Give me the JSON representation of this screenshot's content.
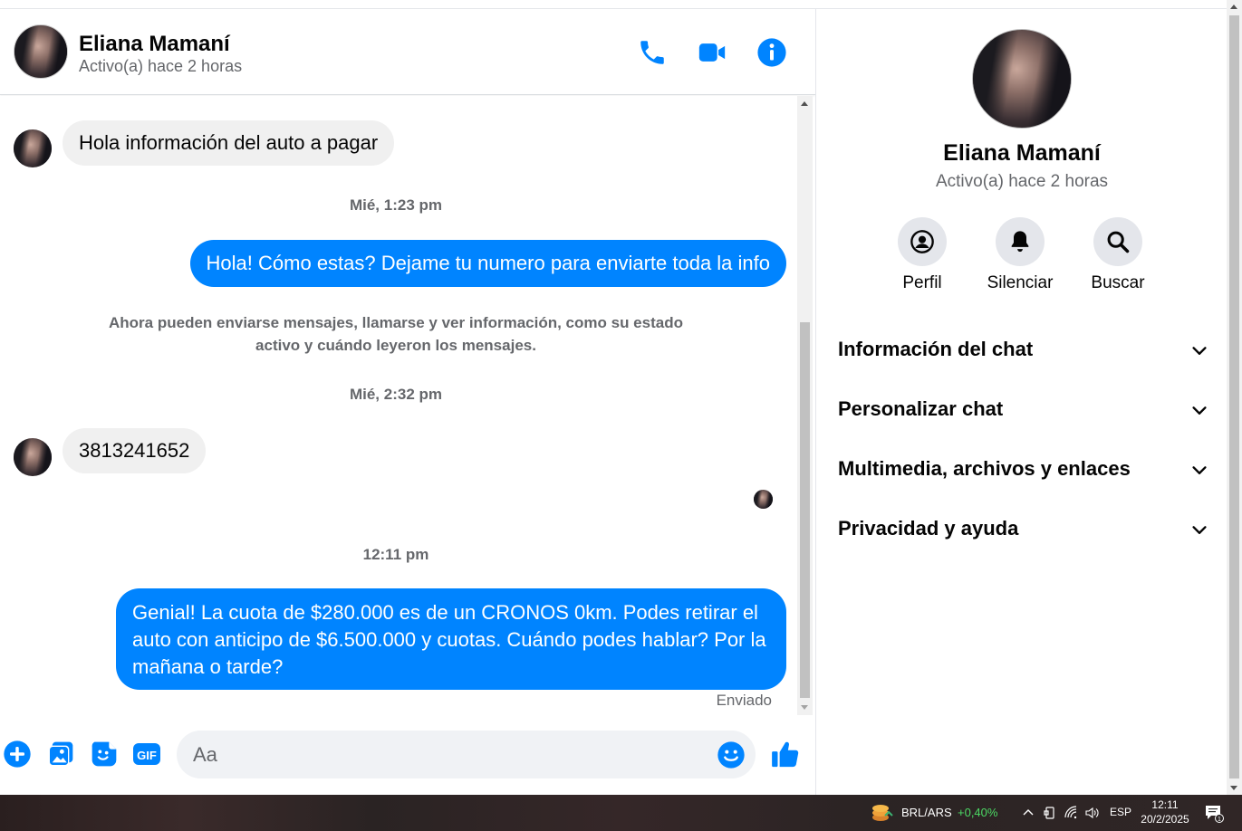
{
  "header": {
    "name": "Eliana Mamaní",
    "status": "Activo(a) hace 2 horas",
    "icons": [
      "phone-icon",
      "video-icon",
      "info-icon"
    ]
  },
  "messages": {
    "m1": "Hola información del auto a pagar",
    "ts1": "Mié, 1:23 pm",
    "m2": "Hola! Cómo estas? Dejame tu numero para enviarte toda la info",
    "sysnote": "Ahora pueden enviarse mensajes, llamarse y ver información, como su estado activo y cuándo leyeron los mensajes.",
    "ts2": "Mié, 2:32 pm",
    "m3": "3813241652",
    "ts3": "12:11 pm",
    "m4": "Genial! La cuota de $280.000 es de un CRONOS 0km. Podes retirar el auto con anticipo de $6.500.000 y cuotas. Cuándo podes hablar? Por la mañana o tarde?",
    "sent_label": "Enviado"
  },
  "composer": {
    "placeholder": "Aa",
    "icons": [
      "plus-icon",
      "image-icon",
      "sticker-icon",
      "gif-icon",
      "emoji-icon",
      "like-icon"
    ],
    "gif_label": "GIF"
  },
  "right_panel": {
    "name": "Eliana Mamaní",
    "status": "Activo(a) hace 2 horas",
    "actions": [
      "Perfil",
      "Silenciar",
      "Buscar"
    ],
    "sections": [
      "Información del chat",
      "Personalizar chat",
      "Multimedia, archivos y enlaces",
      "Privacidad y ayuda"
    ]
  },
  "taskbar": {
    "ticker": "BRL/ARS",
    "change": "+0,40%",
    "lang": "ESP",
    "time": "12:11",
    "date": "20/2/2025",
    "notif_count": "1"
  },
  "colors": {
    "accent": "#0084ff",
    "incoming_bubble": "#f0f0f0",
    "secondary_text": "#65676b",
    "ticker_up": "#4cd964"
  }
}
